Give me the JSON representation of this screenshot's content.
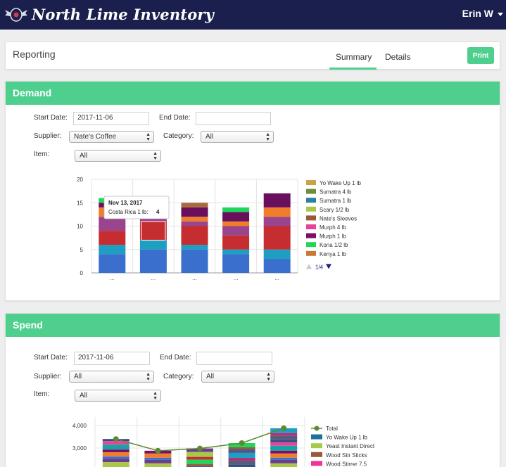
{
  "app": {
    "brand": "North Lime Inventory",
    "user": "Erin W"
  },
  "header": {
    "title": "Reporting",
    "tabs": [
      {
        "label": "Summary",
        "active": true
      },
      {
        "label": "Details",
        "active": false
      }
    ],
    "print_label": "Print"
  },
  "colors": {
    "topbar": "#1b1f4d",
    "accent": "#4fcf8d"
  },
  "demand": {
    "title": "Demand",
    "labels": {
      "start_date": "Start Date:",
      "end_date": "End Date:",
      "supplier": "Supplier:",
      "category": "Category:",
      "item": "Item:"
    },
    "start_date": "2017-11-06",
    "end_date": "",
    "supplier": "Nate's Coffee",
    "category": "All",
    "item": "All",
    "pager": "1/4",
    "tooltip": {
      "title": "Nov 13, 2017",
      "series": "Costa Rica 1 lb:",
      "value": "4"
    }
  },
  "spend": {
    "title": "Spend",
    "labels": {
      "start_date": "Start Date:",
      "end_date": "End Date:",
      "supplier": "Supplier:",
      "category": "Category:",
      "item": "Item:"
    },
    "start_date": "2017-11-06",
    "end_date": "",
    "supplier": "All",
    "category": "All",
    "item": "All"
  },
  "chart_data": [
    {
      "type": "bar",
      "stacked": true,
      "categories": [
        "...",
        "...",
        "...",
        "...",
        "..."
      ],
      "ylim": [
        0,
        20
      ],
      "yticks": [
        0,
        5,
        10,
        15,
        20
      ],
      "grid": true,
      "legend_placement": "right",
      "series": [
        {
          "name": "",
          "color": "#3a6fce",
          "values": [
            4,
            5,
            5,
            4,
            3
          ]
        },
        {
          "name": "",
          "color": "#1e9fc1",
          "values": [
            2,
            2,
            1,
            1,
            2
          ]
        },
        {
          "name": "",
          "color": "#c52d31",
          "values": [
            3,
            4,
            4,
            3,
            5
          ]
        },
        {
          "name": "",
          "color": "#99448c",
          "values": [
            3,
            1,
            1,
            2,
            2
          ]
        },
        {
          "name": "",
          "color": "#f07d2b",
          "values": [
            2,
            2,
            1,
            1,
            2
          ]
        },
        {
          "name": "",
          "color": "#6a0f5e",
          "values": [
            1,
            1,
            2,
            2,
            3
          ]
        },
        {
          "name": "",
          "color": "#1fd85a",
          "values": [
            1,
            0,
            0,
            1,
            0
          ]
        },
        {
          "name": "",
          "color": "#a86b3f",
          "values": [
            0,
            0,
            1,
            0,
            0
          ]
        },
        {
          "name": "",
          "color": "#c9a24a",
          "values": [
            0,
            0,
            0,
            0,
            0
          ]
        }
      ],
      "legend": [
        {
          "name": "Yo Wake Up 1 lb",
          "color": "#c9a24a"
        },
        {
          "name": "Sumatra 4 lb",
          "color": "#6f8f3a"
        },
        {
          "name": "Sumatra 1 lb",
          "color": "#2f7fa3"
        },
        {
          "name": "Scary 1/2 lb",
          "color": "#a9c84a"
        },
        {
          "name": "Nate's Sleeves",
          "color": "#9a5a3a"
        },
        {
          "name": "Murph 4 lb",
          "color": "#e8439a"
        },
        {
          "name": "Murph 1 lb",
          "color": "#7a0f6a"
        },
        {
          "name": "Kona 1/2 lb",
          "color": "#22d45a"
        },
        {
          "name": "Kenya 1 lb",
          "color": "#c87a35"
        }
      ]
    },
    {
      "type": "bar",
      "stacked": true,
      "line_series": {
        "name": "Total",
        "color": "#5a8a32",
        "values": [
          3400,
          2880,
          2980,
          3220,
          3880
        ]
      },
      "categories": [
        "...",
        "...",
        "...",
        "...",
        "..."
      ],
      "yticks": [
        "4,000",
        "3,000"
      ],
      "ytick_values": [
        4000,
        3000
      ],
      "ylim_visible": [
        2200,
        4100
      ],
      "grid": true,
      "legend_placement": "right",
      "bar_totals": [
        3400,
        2880,
        2980,
        3220,
        3880
      ],
      "legend": [
        {
          "name": "Total",
          "color": "#5a8a32",
          "marker": "line"
        },
        {
          "name": "Yo Wake Up 1 lb",
          "color": "#1f6fa0"
        },
        {
          "name": "Yeast Instant Direct",
          "color": "#a9c84a"
        },
        {
          "name": "Wood Stir Sticks",
          "color": "#9a5a3a"
        },
        {
          "name": "Wood Stirrer 7.5",
          "color": "#f0339a"
        }
      ]
    }
  ]
}
